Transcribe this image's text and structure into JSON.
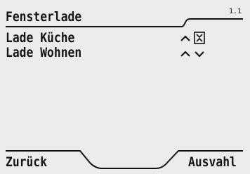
{
  "header": {
    "title": "Fensterlade",
    "page_indicator": "1.1"
  },
  "menu": {
    "items": [
      {
        "label": "Lade Küche",
        "controls": [
          "up-arrow-icon",
          "stop-icon"
        ]
      },
      {
        "label": "Lade Wohnen",
        "controls": [
          "up-arrow-icon",
          "down-arrow-icon"
        ]
      }
    ]
  },
  "softkeys": {
    "left_label": "Zurück",
    "right_label": "Ausvahl"
  },
  "colors": {
    "background": "#ececec",
    "foreground": "#141414"
  }
}
